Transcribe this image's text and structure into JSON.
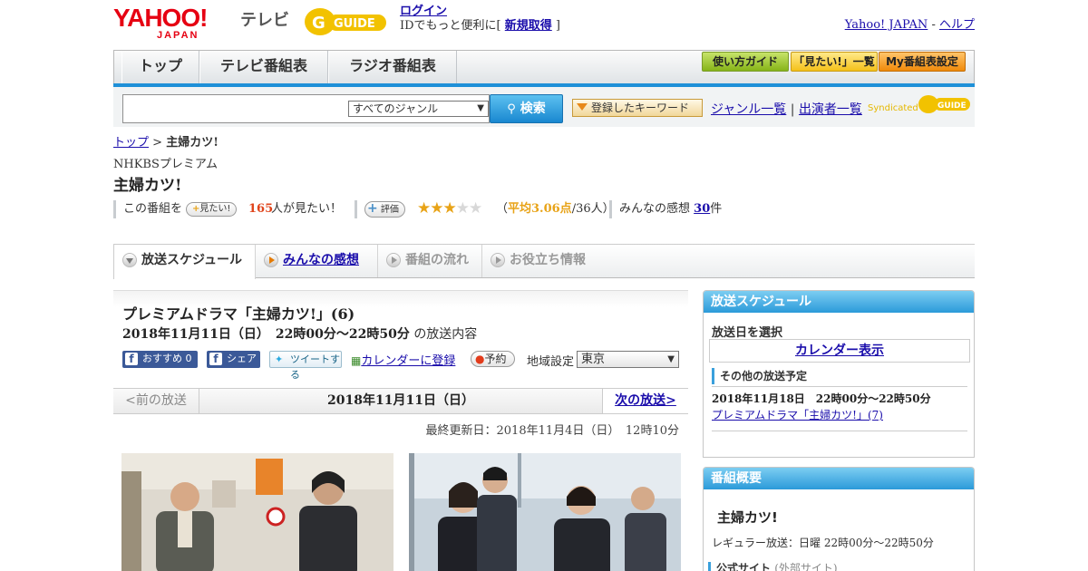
{
  "header": {
    "logo_yahoo": "YAHOO!",
    "logo_japan": "JAPAN",
    "logo_tv": "テレビ",
    "logo_gguide": "GUIDE",
    "login": "ログイン",
    "login_note_pre": "IDでもっと便利に[ ",
    "signup": "新規取得",
    "login_note_post": " ]",
    "yahoo_japan": "Yahoo! JAPAN",
    "dash": " - ",
    "help": "ヘルプ"
  },
  "nav": {
    "tabs": [
      "トップ",
      "テレビ番組表",
      "ラジオ番組表"
    ],
    "buttons": [
      "使い方ガイド",
      "「見たい!」一覧",
      "My番組表設定"
    ]
  },
  "search": {
    "genre_selected": "すべてのジャンル",
    "search_button": "検索",
    "keyword_button": "登録したキーワード",
    "genre_list": "ジャンル一覧",
    "divider": " | ",
    "performer_list": "出演者一覧",
    "syndicated": "Syndicated",
    "syndicated_logo": "GUIDE"
  },
  "breadcrumb": {
    "top": "トップ",
    "sep": " > ",
    "current": "主婦カツ!"
  },
  "program": {
    "channel": "NHKBSプレミアム",
    "title": "主婦カツ!",
    "want_prefix": "この番組を",
    "want_button": "見たい!",
    "want_count": "165",
    "want_suffix": "人が見たい！",
    "rate_button": "評価",
    "stars_on": "★★★",
    "stars_off": "★★",
    "rating_open": "（",
    "rating_avg": "平均3.06点",
    "rating_people": "/36人）",
    "impressions_label": "みんなの感想",
    "impressions_count": "30",
    "impressions_unit": "件",
    "star_color": "#e8a317",
    "want_count_color": "#e0441b"
  },
  "tabs": [
    "放送スケジュール",
    "みんなの感想",
    "番組の流れ",
    "お役立ち情報"
  ],
  "episode": {
    "title": "プレミアムドラマ「主婦カツ!」(6)",
    "date": "2018年11月11日（日）　22時00分～22時50分",
    "date_suffix": "の放送内容",
    "recommend": "おすすめ",
    "recommend_count": "0",
    "share": "シェア",
    "tweet": "ツイートする",
    "calendar": "カレンダーに登録",
    "reserve": "予約",
    "region_label": "地域設定",
    "region_value": "東京",
    "prev": "<前の放送",
    "current_date": "2018年11月11日（日）",
    "next": "次の放送>",
    "updated": "最終更新日：2018年11月4日（日）　12時10分"
  },
  "sidebar": {
    "schedule_title": "放送スケジュール",
    "select_date": "放送日を選択",
    "calendar_display": "カレンダー表示",
    "other_title": "その他の放送予定",
    "other_date": "2018年11月18日　22時00分～22時50分",
    "other_link": "プレミアムドラマ「主婦カツ!」(7)",
    "overview_title": "番組概要",
    "overview_program": "主婦カツ!",
    "regular": "レギュラー放送：日曜 22時00分～22時50分",
    "official_site": "公式サイト",
    "external": "(外部サイト)"
  }
}
